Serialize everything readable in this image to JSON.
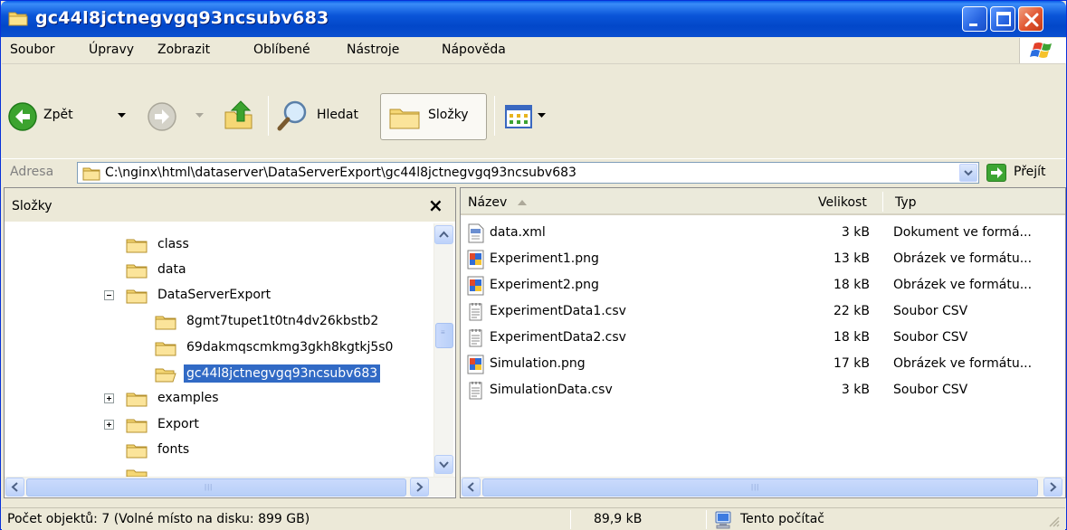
{
  "window": {
    "title": "gc44l8jctnegvgq93ncsubv683"
  },
  "menu": {
    "items": [
      "Soubor",
      "Úpravy",
      "Zobrazit",
      "Oblíbené",
      "Nástroje",
      "Nápověda"
    ]
  },
  "toolbar": {
    "back_label": "Zpět",
    "search_label": "Hledat",
    "folders_label": "Složky"
  },
  "address": {
    "label": "Adresa",
    "path": "C:\\nginx\\html\\dataserver\\DataServerExport\\gc44l8jctnegvgq93ncsubv683",
    "go_label": "Přejít"
  },
  "folders_pane": {
    "title": "Složky",
    "close_glyph": "×",
    "tree": [
      {
        "label": "class",
        "level": 0,
        "expander": "none"
      },
      {
        "label": "data",
        "level": 0,
        "expander": "none"
      },
      {
        "label": "DataServerExport",
        "level": 0,
        "expander": "minus"
      },
      {
        "label": "8gmt7tupet1t0tn4dv26kbstb2",
        "level": 1,
        "expander": "none"
      },
      {
        "label": "69dakmqscmkmg3gkh8kgtkj5s0",
        "level": 1,
        "expander": "none"
      },
      {
        "label": "gc44l8jctnegvgq93ncsubv683",
        "level": 1,
        "expander": "none",
        "selected": true
      },
      {
        "label": "examples",
        "level": 0,
        "expander": "plus"
      },
      {
        "label": "Export",
        "level": 0,
        "expander": "plus"
      },
      {
        "label": "fonts",
        "level": 0,
        "expander": "none"
      }
    ]
  },
  "file_list": {
    "columns": {
      "name": "Název",
      "size": "Velikost",
      "type": "Typ"
    },
    "files": [
      {
        "name": "data.xml",
        "size": "3 kB",
        "type": "Dokument ve formá...",
        "icon": "xml-file-icon"
      },
      {
        "name": "Experiment1.png",
        "size": "13 kB",
        "type": "Obrázek ve formátu...",
        "icon": "png-image-icon"
      },
      {
        "name": "Experiment2.png",
        "size": "18 kB",
        "type": "Obrázek ve formátu...",
        "icon": "png-image-icon"
      },
      {
        "name": "ExperimentData1.csv",
        "size": "22 kB",
        "type": "Soubor CSV",
        "icon": "csv-file-icon"
      },
      {
        "name": "ExperimentData2.csv",
        "size": "18 kB",
        "type": "Soubor CSV",
        "icon": "csv-file-icon"
      },
      {
        "name": "Simulation.png",
        "size": "17 kB",
        "type": "Obrázek ve formátu...",
        "icon": "png-image-icon"
      },
      {
        "name": "SimulationData.csv",
        "size": "3 kB",
        "type": "Soubor CSV",
        "icon": "csv-file-icon"
      }
    ]
  },
  "status": {
    "objects": "Počet objektů: 7 (Volné místo na disku: 899 GB)",
    "size": "89,9 kB",
    "location": "Tento počítač"
  },
  "colors": {
    "title_bar": "#0A55D8",
    "selection": "#316AC5",
    "window_bg": "#ECE9D8",
    "folder_yellow": "#F5D775"
  }
}
